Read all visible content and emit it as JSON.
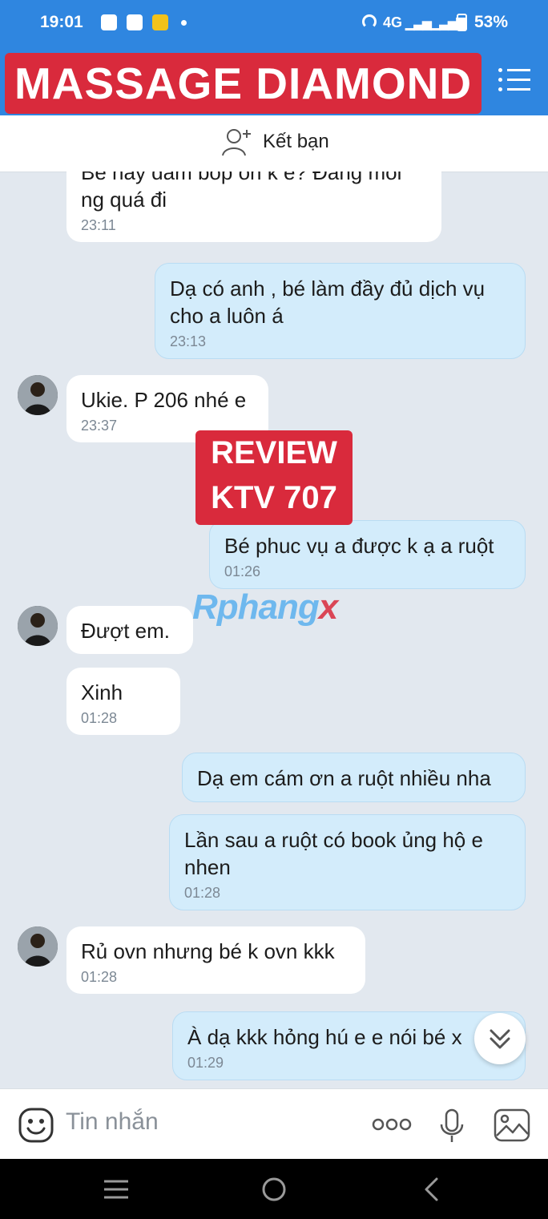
{
  "status_bar": {
    "time": "19:01",
    "network": "4G",
    "battery": "53%",
    "battery_level": 0.53,
    "notification_icons": [
      "shopee-icon",
      "mail-icon",
      "be-app-icon",
      "dot-icon"
    ]
  },
  "header": {
    "title": "MASSAGE DIAMOND",
    "menu_icon": "list-menu-icon",
    "banner_color": "#d92a3c",
    "bar_color": "#2f86e0"
  },
  "friend_bar": {
    "label": "Kết bạn",
    "icon": "add-friend-icon"
  },
  "messages": [
    {
      "direction": "in",
      "text": "Bé này dâm bóp ổn k e? Đang mỏi ng quá đi",
      "time": "23:11"
    },
    {
      "direction": "out",
      "text": "Dạ có anh , bé làm đầy đủ dịch vụ cho a luôn á",
      "time": "23:13"
    },
    {
      "direction": "in",
      "text": "Ukie. P 206 nhé e",
      "time": "23:37",
      "avatar": true
    },
    {
      "direction": "out",
      "text": "Bé phuc vụ a được k ạ a ruột",
      "time": "01:26"
    },
    {
      "direction": "in",
      "text": "Đượt em.",
      "time": "",
      "avatar": true
    },
    {
      "direction": "in",
      "text": "Xinh",
      "time": "01:28"
    },
    {
      "direction": "out",
      "text": "Dạ em cám ơn a ruột nhiều nha",
      "time": ""
    },
    {
      "direction": "out",
      "text": "Lần sau a ruột có book ủng hộ e nhen",
      "time": "01:28"
    },
    {
      "direction": "in",
      "text": "Rủ ovn nhưng bé k ovn kkk",
      "time": "01:28",
      "avatar": true
    },
    {
      "direction": "out",
      "text": "À dạ kkk hỏng hú e e nói bé x",
      "time": "01:29"
    }
  ],
  "overlay": {
    "review_line1": "REVIEW",
    "review_line2": "KTV 707",
    "watermark_main": "Rphang",
    "watermark_x": "x"
  },
  "composer": {
    "placeholder": "Tin nhắn",
    "icons": [
      "emoji-icon",
      "more-options-icon",
      "microphone-icon",
      "image-icon"
    ]
  },
  "scroll_button": {
    "icon": "double-chevron-down-icon"
  },
  "nav_bar": {
    "icons": [
      "recent-apps-icon",
      "home-icon",
      "back-icon"
    ]
  }
}
